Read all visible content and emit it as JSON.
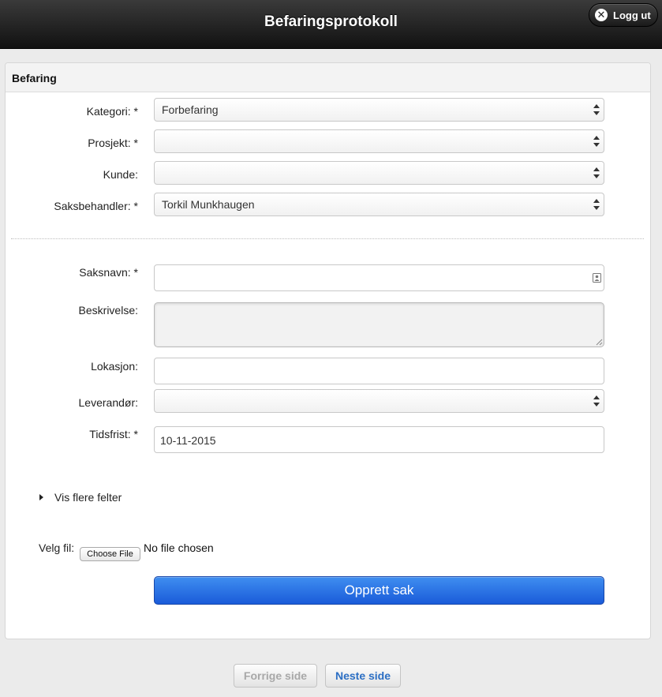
{
  "header": {
    "title": "Befaringsprotokoll",
    "logout_label": "Logg ut",
    "logout_icon": "close-icon"
  },
  "panel": {
    "title": "Befaring"
  },
  "form": {
    "kategori": {
      "label": "Kategori: *",
      "value": "Forbefaring"
    },
    "prosjekt": {
      "label": "Prosjekt: *",
      "value": ""
    },
    "kunde": {
      "label": "Kunde:",
      "value": ""
    },
    "saksbehandler": {
      "label": "Saksbehandler: *",
      "value": "Torkil Munkhaugen"
    },
    "saksnavn": {
      "label": "Saksnavn: *",
      "value": ""
    },
    "beskrivelse": {
      "label": "Beskrivelse:",
      "value": ""
    },
    "lokasjon": {
      "label": "Lokasjon:",
      "value": ""
    },
    "leverandor": {
      "label": "Leverandør:",
      "value": ""
    },
    "tidsfrist": {
      "label": "Tidsfrist: *",
      "value": "10-11-2015"
    }
  },
  "more_fields_label": "Vis flere felter",
  "file": {
    "label": "Velg fil:",
    "button_label": "Choose File",
    "status": "No file chosen"
  },
  "submit_label": "Opprett sak",
  "pager": {
    "prev_label": "Forrige side",
    "next_label": "Neste side"
  },
  "colors": {
    "primary_button": "#1a5bd9",
    "header_bg": "#1a1a1a",
    "next_link": "#2c6fc4"
  }
}
